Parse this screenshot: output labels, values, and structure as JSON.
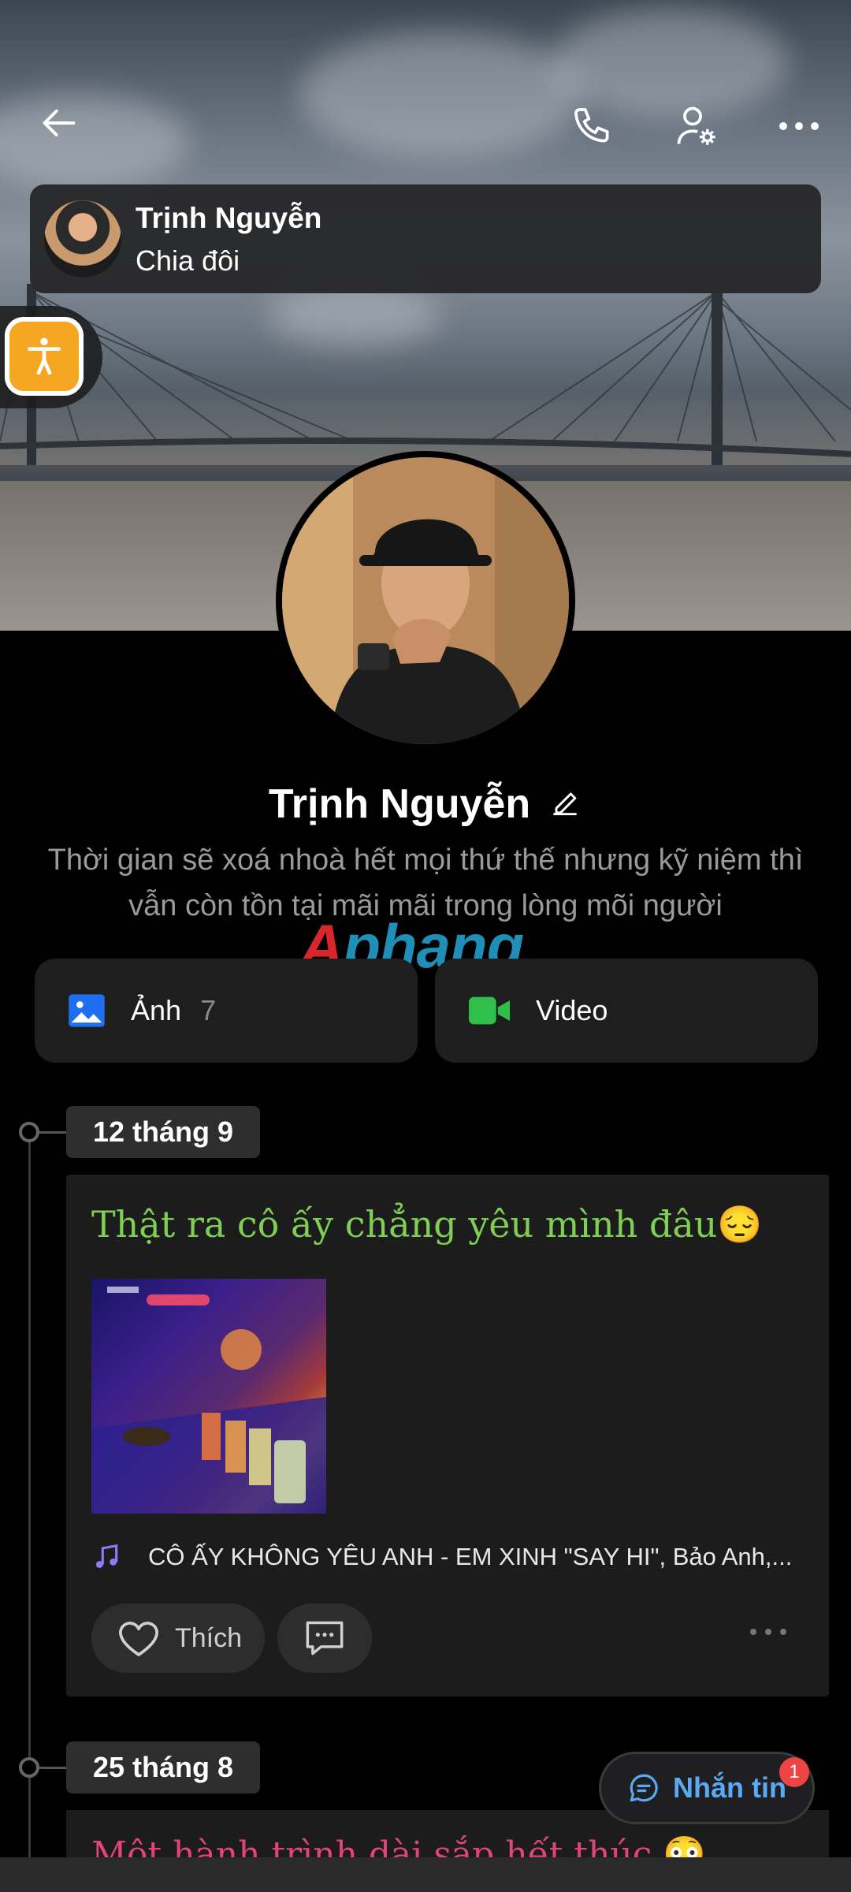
{
  "header": {
    "back_icon": "arrow-left-icon",
    "call_icon": "phone-icon",
    "settings_icon": "user-gear-icon",
    "more_icon": "more-horizontal-icon"
  },
  "account_chip": {
    "name": "Trịnh Nguyễn",
    "subtitle": "Chia đôi"
  },
  "profile": {
    "name": "Trịnh Nguyễn",
    "bio": "Thời gian sẽ xoá nhoà hết mọi thứ thế nhưng kỹ niệm thì vẫn còn tồn tại mãi mãi trong lòng mõi người"
  },
  "watermark": {
    "part1": "A",
    "part2": "phang"
  },
  "tiles": {
    "photos_label": "Ảnh",
    "photos_count": "7",
    "video_label": "Video"
  },
  "timeline": [
    {
      "date": "12 tháng 9",
      "text": "Thật ra cô ấy chẳng yêu mình đâu😔",
      "music": "CÔ ẤY KHÔNG YÊU ANH - EM XINH \"SAY HI\", Bảo Anh,...",
      "like_label": "Thích"
    },
    {
      "date": "25 tháng 8",
      "text": "Một hành trình dài sắp hết thúc 😳"
    }
  ],
  "message_button": {
    "label": "Nhắn tin",
    "badge": "1"
  },
  "colors": {
    "accent_blue": "#5aa9f5",
    "post_green": "#7fcf55",
    "post_pink": "#e0447a",
    "badge_red": "#ef4444",
    "accessibility_orange": "#f5a623"
  }
}
